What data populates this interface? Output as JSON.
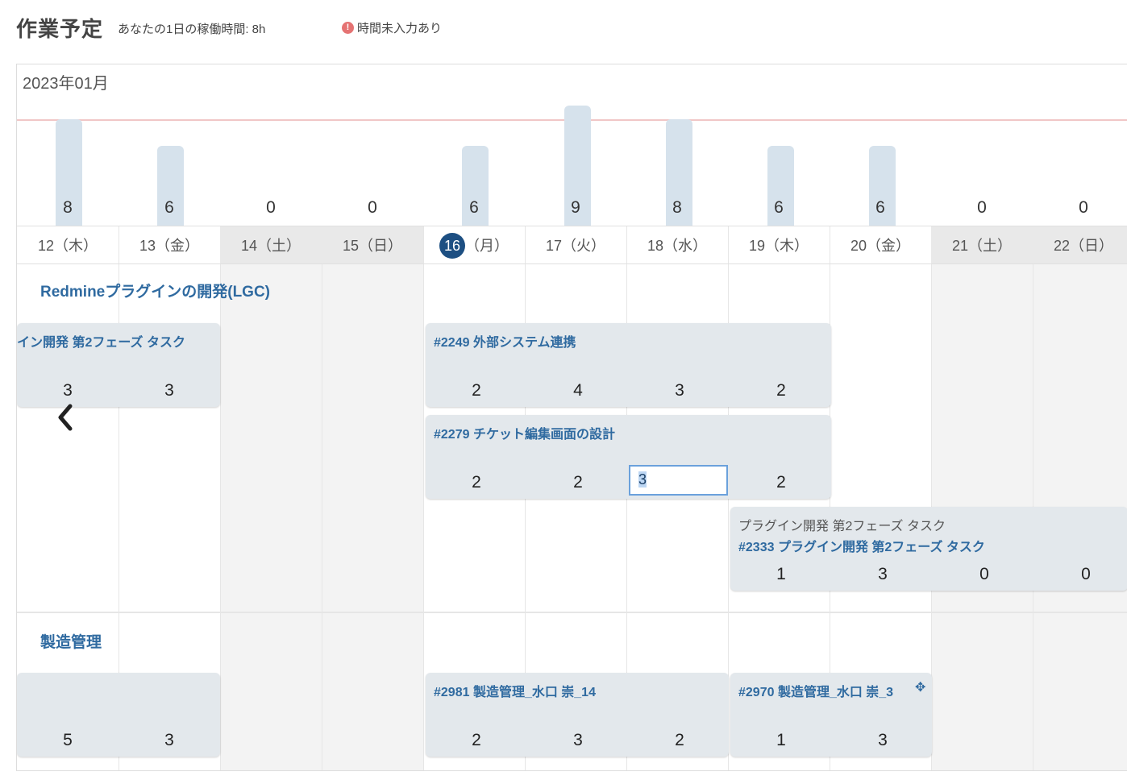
{
  "header": {
    "title": "作業予定",
    "work_hours": "あなたの1日の稼働時間: 8h",
    "warning": "時間未入力あり"
  },
  "calendar": {
    "month": "2023年01月",
    "days": [
      {
        "label": "12（木）",
        "weekend": false,
        "today": false,
        "total": "8"
      },
      {
        "label": "13（金）",
        "weekend": false,
        "today": false,
        "total": "6"
      },
      {
        "label": "14（土）",
        "weekend": true,
        "today": false,
        "total": "0"
      },
      {
        "label": "15（日）",
        "weekend": true,
        "today": false,
        "total": "0"
      },
      {
        "num": "16",
        "label": "（月）",
        "weekend": false,
        "today": true,
        "total": "6"
      },
      {
        "label": "17（火）",
        "weekend": false,
        "today": false,
        "total": "9"
      },
      {
        "label": "18（水）",
        "weekend": false,
        "today": false,
        "total": "8"
      },
      {
        "label": "19（木）",
        "weekend": false,
        "today": false,
        "total": "6"
      },
      {
        "label": "20（金）",
        "weekend": false,
        "today": false,
        "total": "6"
      },
      {
        "label": "21（土）",
        "weekend": true,
        "today": false,
        "total": "0"
      },
      {
        "label": "22（日）",
        "weekend": true,
        "today": false,
        "total": "0"
      }
    ],
    "capacity_hours": 8
  },
  "projects": [
    {
      "name": "Redmineプラグインの開発(LGC)",
      "tasks": [
        {
          "title": "イン開発 第2フェーズ タスク",
          "hours": [
            "3",
            "3"
          ]
        },
        {
          "title": "#2249 外部システム連携",
          "hours": [
            "2",
            "4",
            "3",
            "2"
          ]
        },
        {
          "title": "#2279 チケット編集画面の設計",
          "hours": [
            "2",
            "2",
            "3",
            "2"
          ],
          "editing_value": "3"
        },
        {
          "subtitle": "プラグイン開発 第2フェーズ タスク",
          "title": "#2333 プラグイン開発 第2フェーズ タスク",
          "hours": [
            "1",
            "3",
            "0",
            "0"
          ]
        }
      ]
    },
    {
      "name": "製造管理",
      "tasks": [
        {
          "title": "",
          "hours": [
            "5",
            "3"
          ]
        },
        {
          "title": "#2981 製造管理_水口 崇_14",
          "hours": [
            "2",
            "3",
            "2"
          ]
        },
        {
          "title": "#2970 製造管理_水口 崇_3",
          "hours": [
            "1",
            "3"
          ]
        }
      ]
    }
  ],
  "icons": {
    "warning": "warning-icon",
    "prev": "chevron-left-icon",
    "drag": "drag-handle-icon"
  },
  "colors": {
    "accent": "#2f6aa0",
    "today": "#1d4f82",
    "bar": "#d6e2ec",
    "capacity_line": "#f1c7c7",
    "warning": "#e57373"
  }
}
